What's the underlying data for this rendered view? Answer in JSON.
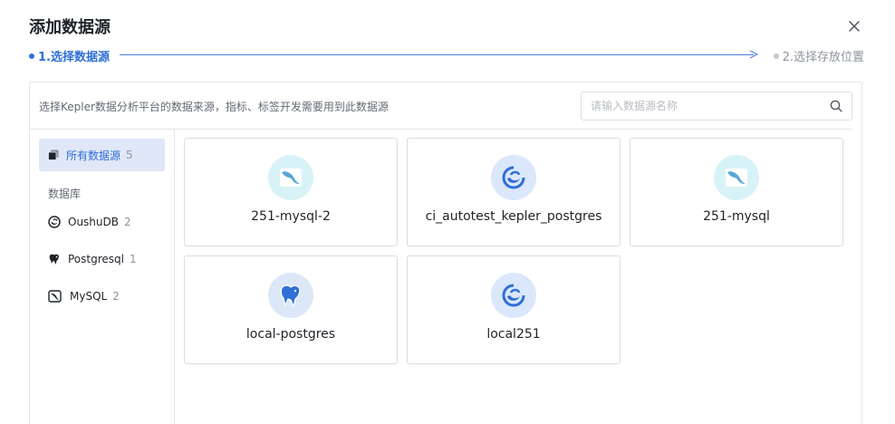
{
  "dialog": {
    "title": "添加数据源",
    "close_label": "×"
  },
  "steps": [
    {
      "label": "1.选择数据源",
      "state": "active"
    },
    {
      "label": "2.选择存放位置",
      "state": "pending"
    }
  ],
  "panel": {
    "description": "选择Kepler数据分析平台的数据来源，指标、标签开发需要用到此数据源",
    "search_placeholder": "请输入数据源名称"
  },
  "sidebar": {
    "all": {
      "label": "所有数据源",
      "count": "5"
    },
    "section_label": "数据库",
    "items": [
      {
        "label": "OushuDB",
        "count": "2",
        "icon": "oushudb-icon"
      },
      {
        "label": "Postgresql",
        "count": "1",
        "icon": "postgresql-icon"
      },
      {
        "label": "MySQL",
        "count": "2",
        "icon": "mysql-icon"
      }
    ]
  },
  "cards": [
    {
      "name": "251-mysql-2",
      "type": "mysql"
    },
    {
      "name": "ci_autotest_kepler_postgres",
      "type": "oushudb"
    },
    {
      "name": "251-mysql",
      "type": "mysql"
    },
    {
      "name": "local-postgres",
      "type": "postgresql"
    },
    {
      "name": "local251",
      "type": "oushudb"
    }
  ],
  "colors": {
    "accent": "#2f6fd6",
    "active_bg": "#dfe7f8",
    "mysql_bg": "#d8f3f7",
    "oushu_bg": "#dbe7fb",
    "pg_bg": "#dce8f8"
  }
}
